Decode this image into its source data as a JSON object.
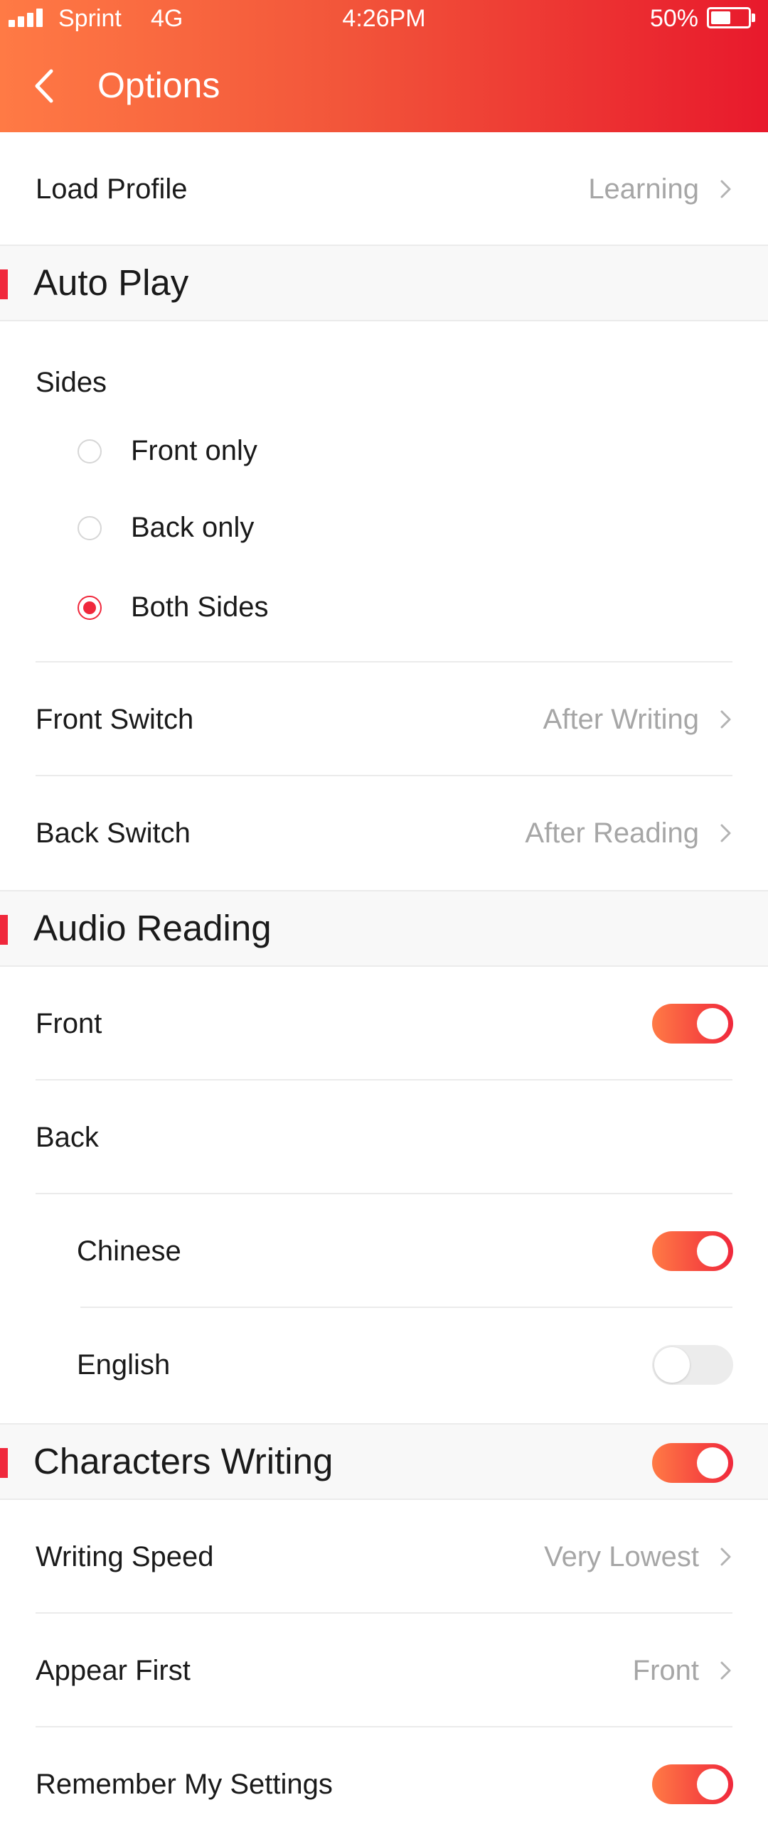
{
  "status_bar": {
    "carrier": "Sprint",
    "network": "4G",
    "time": "4:26PM",
    "battery_percent": "50%"
  },
  "header": {
    "title": "Options",
    "back_icon": "chevron-left-icon"
  },
  "load_profile": {
    "label": "Load Profile",
    "value": "Learning"
  },
  "auto_play": {
    "title": "Auto Play",
    "sides": {
      "label": "Sides",
      "options": [
        {
          "label": "Front only",
          "selected": false
        },
        {
          "label": "Back only",
          "selected": false
        },
        {
          "label": "Both Sides",
          "selected": true
        }
      ]
    },
    "front_switch": {
      "label": "Front Switch",
      "value": "After Writing"
    },
    "back_switch": {
      "label": "Back Switch",
      "value": "After Reading"
    }
  },
  "audio_reading": {
    "title": "Audio Reading",
    "front": {
      "label": "Front",
      "on": true
    },
    "back": {
      "label": "Back"
    },
    "chinese": {
      "label": "Chinese",
      "on": true
    },
    "english": {
      "label": "English",
      "on": false
    }
  },
  "characters_writing": {
    "title": "Characters Writing",
    "on": true,
    "writing_speed": {
      "label": "Writing Speed",
      "value": "Very Lowest"
    },
    "appear_first": {
      "label": "Appear First",
      "value": "Front"
    },
    "remember": {
      "label": "Remember My Settings",
      "on": true
    }
  },
  "colors": {
    "accent": "#f0283c",
    "header_gradient_start": "#ff7a45",
    "header_gradient_end": "#e8192c",
    "secondary_text": "#a6a6a6"
  }
}
